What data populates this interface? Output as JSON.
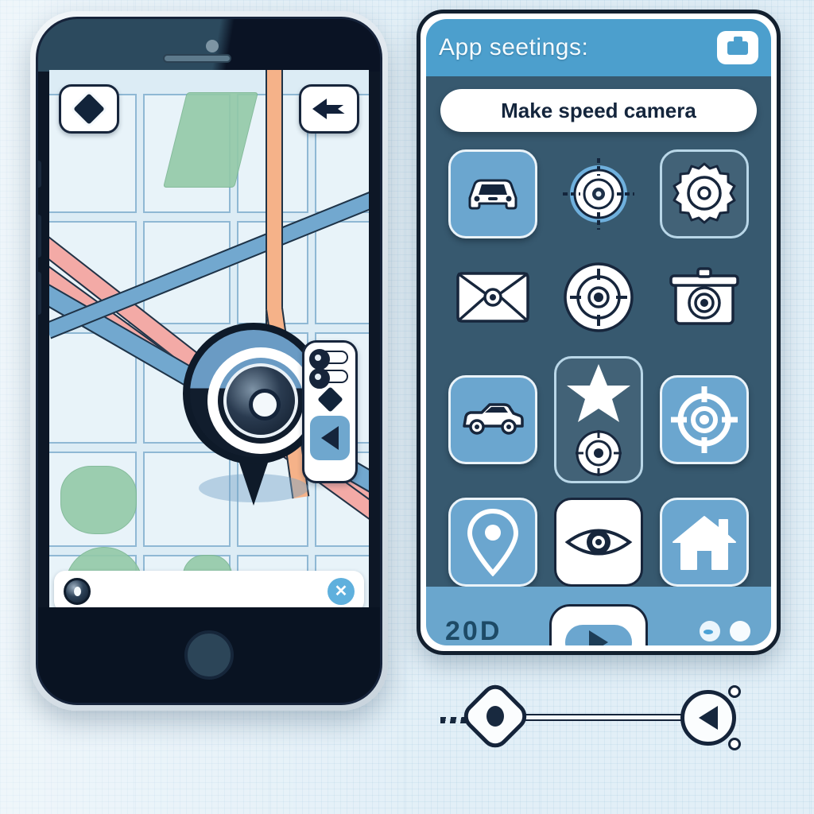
{
  "app": {
    "background_color": "#e2eff7",
    "accent_color": "#4c9fcd",
    "panel_body_color": "#37596f"
  },
  "phone": {
    "map": {
      "top_left_button": {
        "icon": "diamond-marker-icon",
        "label": ""
      },
      "top_right_button": {
        "icon": "back-arrow-icon",
        "label": ""
      },
      "pin": {
        "icon": "camera-lens-pin-icon",
        "label": ""
      },
      "road_colors": {
        "primary": "#f3aaa6",
        "secondary": "#72a8cf",
        "tertiary": "#f5b289"
      },
      "park_color": "#93c9a7",
      "block_color": "#e8f3f9"
    },
    "side_controls": {
      "toggle_one": {
        "icon": "toggle-switch-icon",
        "state": "off"
      },
      "toggle_two": {
        "icon": "toggle-switch-icon",
        "state": "off"
      },
      "marker": {
        "icon": "diamond-icon"
      },
      "back": {
        "icon": "triangle-left-icon",
        "label": ""
      }
    },
    "search_bar": {
      "left_icon": "camera-lens-icon",
      "value": "",
      "placeholder": "",
      "clear_button": {
        "icon": "close-x-icon",
        "label": "✕"
      }
    },
    "home_button": {
      "icon": "home-button-icon"
    }
  },
  "settings_panel": {
    "header": {
      "title": "App seetings:",
      "badge_icon": "camera-badge-icon"
    },
    "cta_button": {
      "label": "Make  speed camera"
    },
    "icon_grid": [
      {
        "icon": "car-front-icon",
        "tile": "blue",
        "label": ""
      },
      {
        "icon": "target-crosshair-icon",
        "tile": "plain",
        "label": ""
      },
      {
        "icon": "gear-settings-icon",
        "tile": "outline",
        "label": ""
      },
      {
        "icon": "mail-envelope-icon",
        "tile": "plain",
        "label": ""
      },
      {
        "icon": "target-circle-icon",
        "tile": "plain",
        "label": ""
      },
      {
        "icon": "camera-icon",
        "tile": "plain",
        "label": ""
      },
      {
        "icon": "car-side-icon",
        "tile": "blue",
        "label": ""
      },
      {
        "icon": "star-favorite-icon",
        "tile": "outline",
        "label": ""
      },
      {
        "icon": "target-crosshair-icon",
        "tile": "blue",
        "label": ""
      },
      {
        "icon": "map-pin-icon",
        "tile": "blue",
        "label": ""
      },
      {
        "icon": "eye-visibility-icon",
        "tile": "white",
        "label": ""
      },
      {
        "icon": "house-home-icon",
        "tile": "blue",
        "label": ""
      }
    ],
    "footer": {
      "speed_value": "20D",
      "play_button": {
        "icon": "play-triangle-icon",
        "label": ""
      },
      "indicator_dots": [
        "eye-dot-icon",
        "plain-dot-icon"
      ]
    }
  },
  "connector": {
    "left_node": {
      "icon": "eye-node-icon"
    },
    "right_node": {
      "icon": "back-arrow-node-icon"
    },
    "dashes": "motion-dashes-icon"
  }
}
